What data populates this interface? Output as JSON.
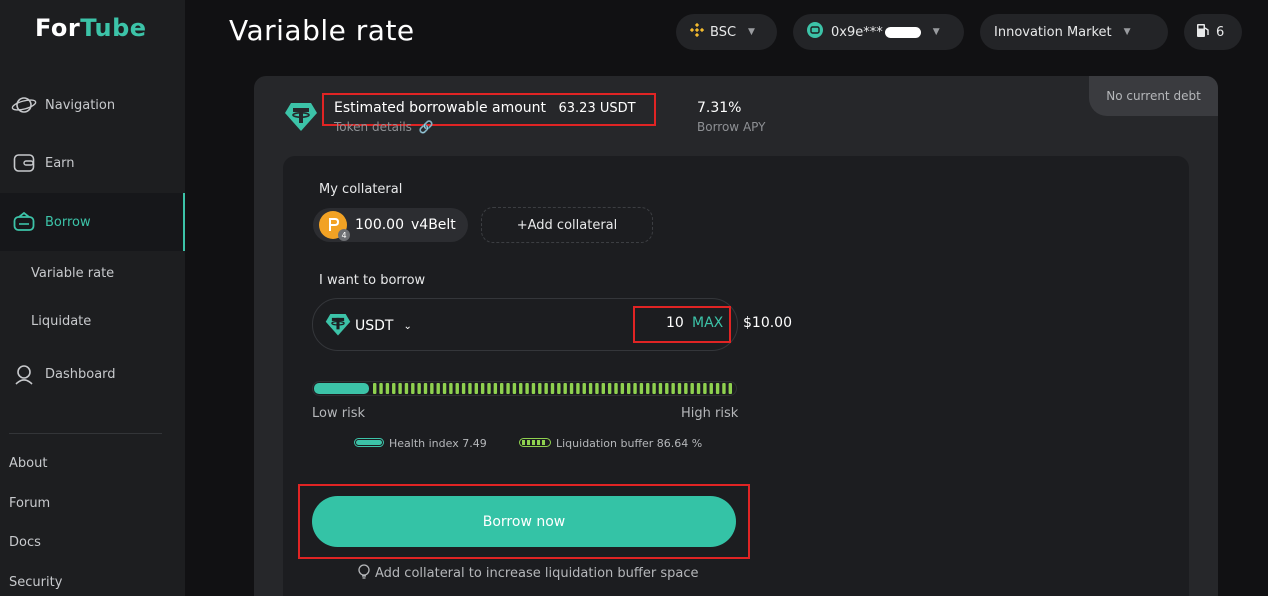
{
  "brand": {
    "logo_text_1": "For",
    "logo_text_2": "Tube"
  },
  "sidebar": {
    "items": [
      {
        "label": "Navigation",
        "icon": "planet-icon"
      },
      {
        "label": "Earn",
        "icon": "wallet-icon"
      },
      {
        "label": "Borrow",
        "icon": "borrow-icon",
        "active": true
      },
      {
        "label": "Dashboard",
        "icon": "user-icon"
      }
    ],
    "subitems": [
      "Variable rate",
      "Liquidate"
    ],
    "footer_links": [
      "About",
      "Forum",
      "Docs",
      "Security"
    ]
  },
  "header": {
    "title": "Variable rate",
    "network": "BSC",
    "wallet": "0x9e***",
    "market": "Innovation Market",
    "gas_count": "6"
  },
  "card": {
    "debt_status": "No current debt",
    "estimate_label": "Estimated borrowable amount",
    "estimate_value": "63.23 USDT",
    "token_details": "Token details",
    "apy_value": "7.31%",
    "apy_label": "Borrow APY"
  },
  "collateral": {
    "label": "My collateral",
    "amount": "100.00",
    "token": "v4Belt",
    "badge": "4",
    "add_label": "+Add collateral"
  },
  "borrow": {
    "label": "I want to borrow",
    "token": "USDT",
    "amount": "10",
    "max_label": "MAX",
    "usd_value": "$10.00"
  },
  "risk": {
    "low_label": "Low risk",
    "high_label": "High risk",
    "health_fill": 0.13,
    "health_text": "Health index 7.49",
    "buffer_text": "Liquidation buffer 86.64 %"
  },
  "actions": {
    "borrow_label": "Borrow now",
    "hint": "Add collateral to increase liquidation buffer space"
  },
  "colors": {
    "accent": "#3cc3a8",
    "highlight": "#e02424",
    "green_seg": "#8fd14f"
  }
}
